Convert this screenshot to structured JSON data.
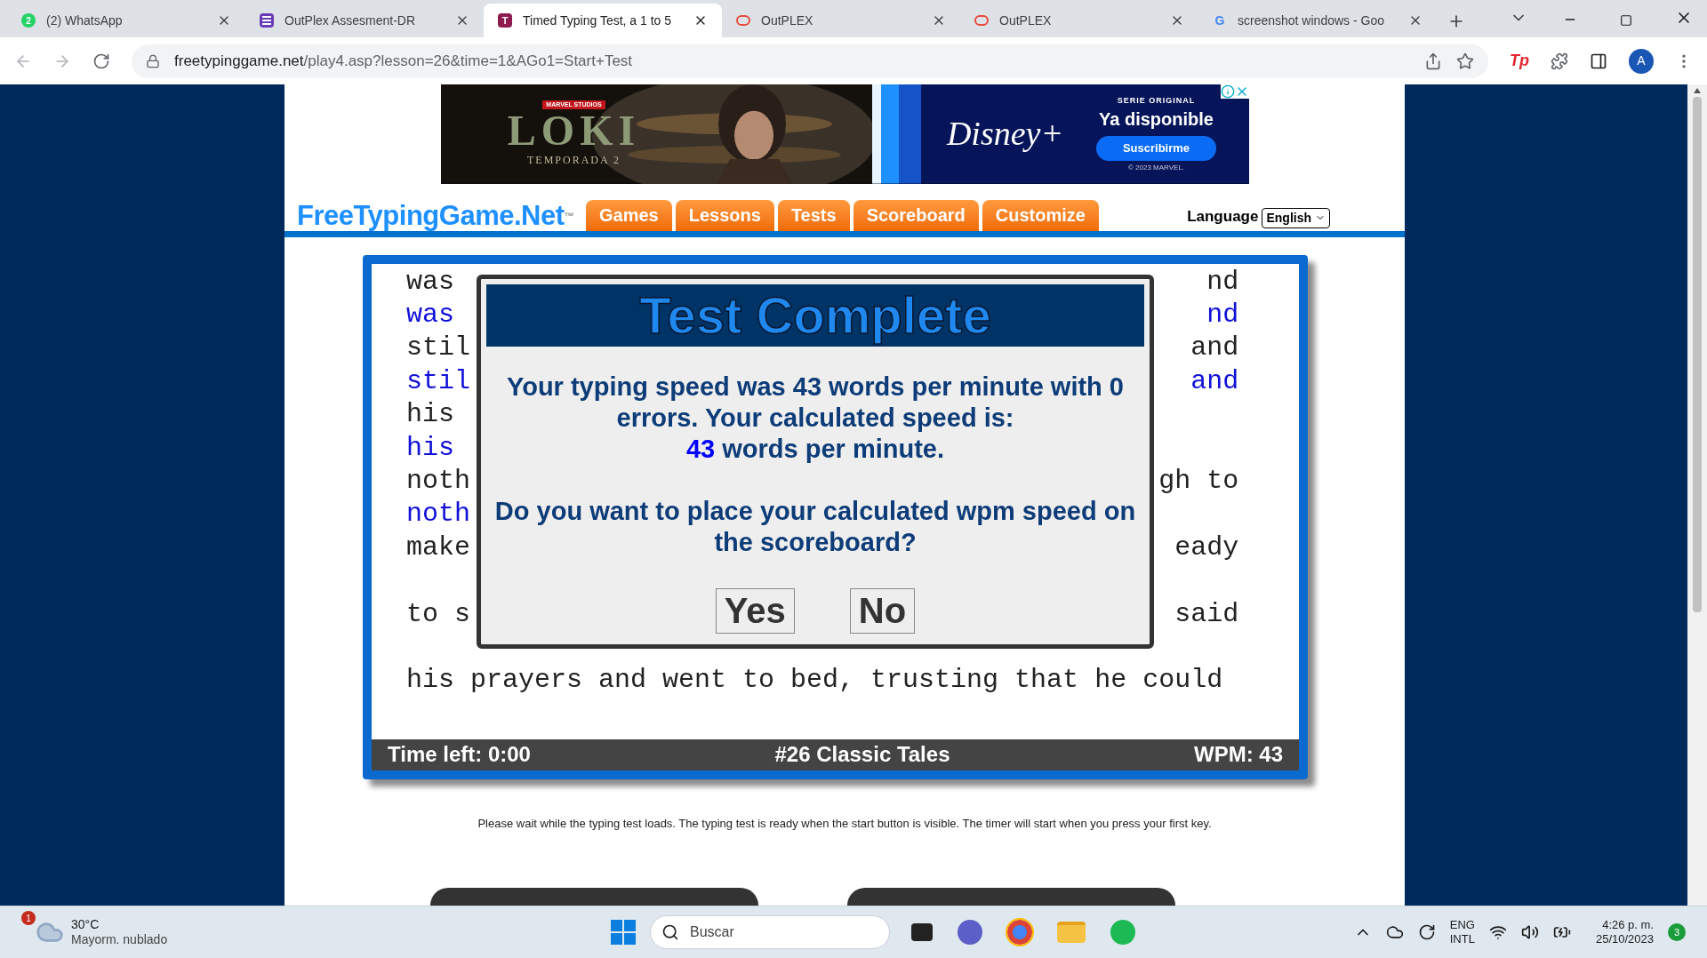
{
  "browser": {
    "tabs": [
      {
        "title": "(2) WhatsApp",
        "badge": "2",
        "selected": false
      },
      {
        "title": "OutPlex Assesment-DR",
        "selected": false
      },
      {
        "title": "Timed Typing Test, a 1 to 5",
        "badge": "T",
        "selected": true
      },
      {
        "title": "OutPLEX",
        "selected": false
      },
      {
        "title": "OutPLEX",
        "selected": false
      },
      {
        "title": "screenshot windows - Goo",
        "badge": "G",
        "selected": false
      }
    ],
    "url_host": "freetypinggame.net",
    "url_path": "/play4.asp?lesson=26&time=1&AGo1=Start+Test",
    "profile": "A",
    "extension_badge": "Tp"
  },
  "ad": {
    "studio": "MARVEL STUDIOS",
    "title": "LOKI",
    "season": "TEMPORADA 2",
    "brand": "Disney+",
    "tag": "SERIE ORIGINAL",
    "headline": "Ya disponible",
    "button": "Suscribirme",
    "copyright": "© 2023 MARVEL."
  },
  "site": {
    "logo": "FreeTypingGame.Net",
    "logo_mark": "™",
    "nav": [
      "Games",
      "Lessons",
      "Tests",
      "Scoreboard",
      "Customize"
    ],
    "language_label": "Language",
    "language_value": "English"
  },
  "typing": {
    "rows": [
      {
        "kind": "prompt",
        "left": "was",
        "right": "nd"
      },
      {
        "kind": "typed",
        "left": "was",
        "right": "nd"
      },
      {
        "kind": "prompt",
        "left": "stil",
        "right": "and"
      },
      {
        "kind": "typed",
        "left": "stil",
        "right": "and"
      },
      {
        "kind": "prompt",
        "left": "his"
      },
      {
        "kind": "typed",
        "left": "his"
      },
      {
        "kind": "prompt",
        "left": "noth",
        "right": "gh to"
      },
      {
        "kind": "typed",
        "left": "noth"
      },
      {
        "kind": "prompt",
        "left": "make",
        "right": "eady"
      },
      {
        "kind": "typed"
      },
      {
        "kind": "prompt",
        "left": "to s",
        "right": "said"
      },
      {
        "kind": "typed"
      },
      {
        "kind": "prompt",
        "left": "his prayers and went to bed, trusting that he could"
      }
    ],
    "status": {
      "time_left": "Time left: 0:00",
      "lesson": "#26 Classic Tales",
      "wpm": "WPM: 43"
    }
  },
  "dialog": {
    "title": "Test Complete",
    "message": "Your typing speed was 43 words per minute with 0 errors. Your calculated speed is:",
    "speed_value": "43",
    "speed_unit": "words per minute.",
    "question": "Do you want to place your calculated wpm speed on the scoreboard?",
    "buttons": [
      "Yes",
      "No"
    ]
  },
  "note": "Please wait while the typing test loads. The typing test is ready when the start button is visible. The timer will start when you press your first key.",
  "taskbar": {
    "weather_badge": "1",
    "temperature": "30°C",
    "weather": "Mayorm. nublado",
    "search_placeholder": "Buscar",
    "language": "ENG",
    "layout": "INTL",
    "time": "4:26 p. m.",
    "date": "25/10/2023",
    "notifications": "3"
  }
}
